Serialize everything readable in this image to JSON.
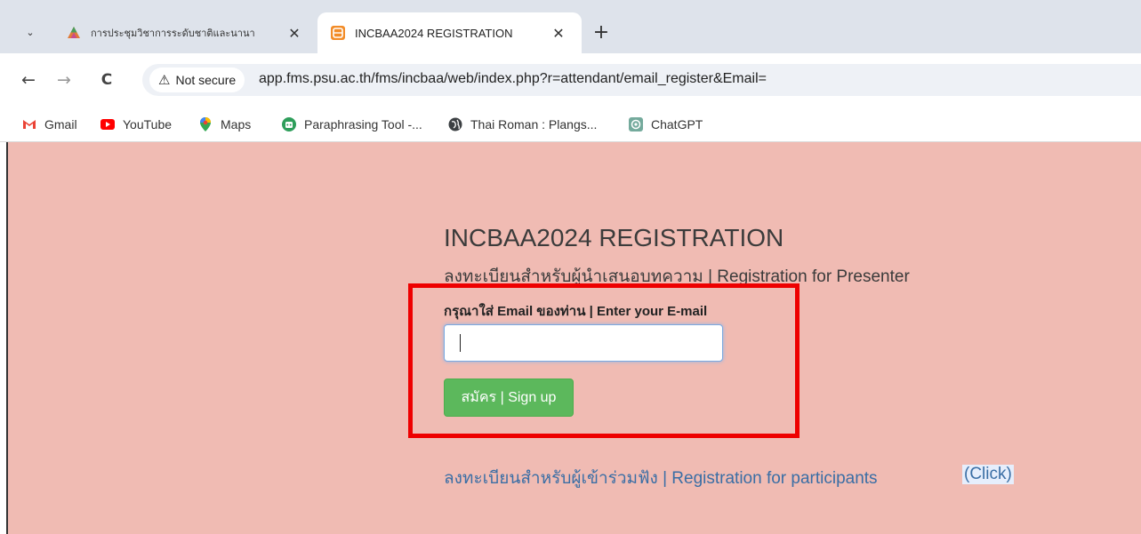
{
  "browser": {
    "tabs": [
      {
        "title": "การประชุมวิชาการระดับชาติและนานา",
        "active": false,
        "favicon": "colorful-triangle-icon"
      },
      {
        "title": "INCBAA2024 REGISTRATION",
        "active": true,
        "favicon": "orange-app-icon"
      }
    ],
    "new_tab_symbol": "+",
    "close_symbol": "✕",
    "tab_search_symbol": "⌄",
    "nav": {
      "back": "←",
      "forward": "→",
      "reload": "C"
    },
    "security_warning": "Not secure",
    "url": "app.fms.psu.ac.th/fms/incbaa/web/index.php?r=attendant/email_register&Email=",
    "bookmarks": [
      {
        "label": "Gmail",
        "icon": "gmail-icon"
      },
      {
        "label": "YouTube",
        "icon": "youtube-icon"
      },
      {
        "label": "Maps",
        "icon": "maps-pin-icon"
      },
      {
        "label": "Paraphrasing Tool -...",
        "icon": "paraphrasing-tool-icon"
      },
      {
        "label": "Thai Roman : Plangs...",
        "icon": "globe-icon"
      },
      {
        "label": "ChatGPT",
        "icon": "chatgpt-icon"
      }
    ]
  },
  "page": {
    "title": "INCBAA2024 REGISTRATION",
    "subtitle": "ลงทะเบียนสำหรับผู้นำเสนอบทความ | Registration for Presenter",
    "email_label": "กรุณาใส่ Email ของท่าน | Enter your E-mail",
    "email_value": "",
    "signup_label": "สมัคร | Sign up",
    "participants_link": "ลงทะเบียนสำหรับผู้เข้าร่วมฟัง | Registration for participants",
    "click_label": "(Click)",
    "background_color": "#f0bbb3",
    "button_color": "#5cb85c",
    "highlight_color": "#ee0000",
    "link_color": "#3a6ea5"
  }
}
